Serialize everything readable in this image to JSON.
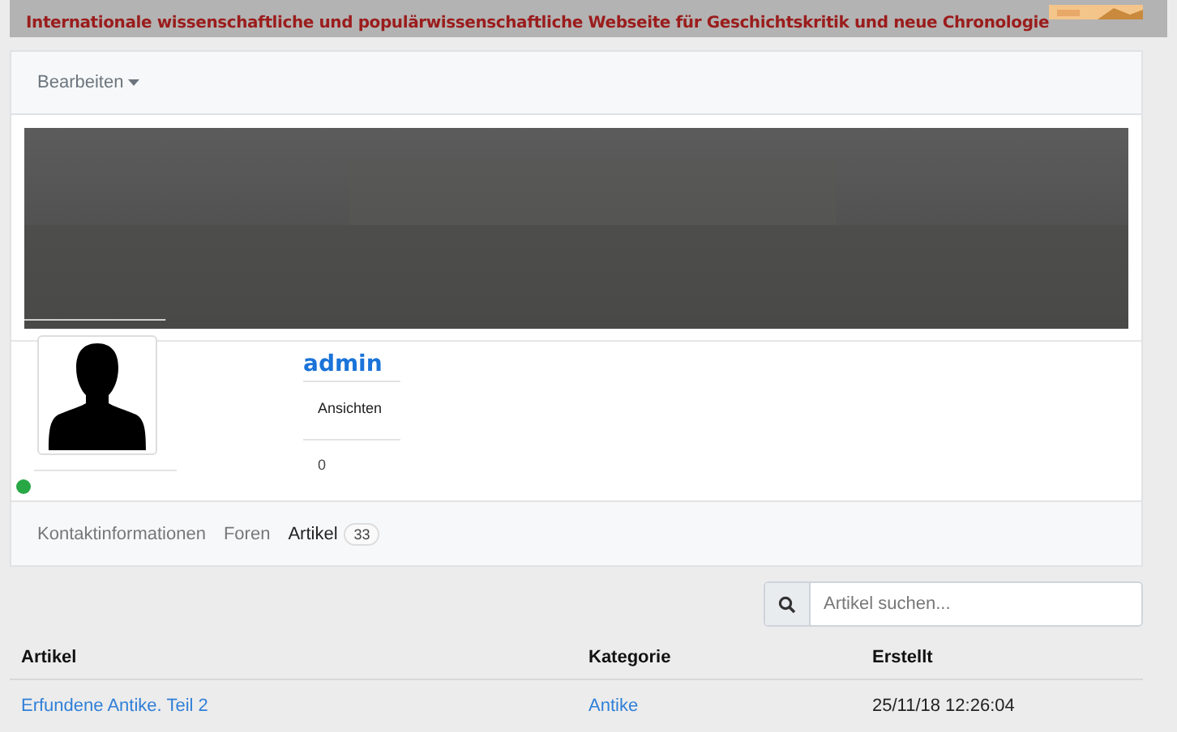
{
  "banner": {
    "tagline": "Internationale wissenschaftliche und populärwissenschaftliche Webseite für Geschichtskritik und neue Chronologie"
  },
  "toolbar": {
    "menu": "Bearbeiten"
  },
  "profile": {
    "name": "admin",
    "stat_label": "Ansichten",
    "stat_value": "0",
    "online": true
  },
  "tabs": [
    {
      "label": "Kontaktinformationen",
      "selected": false
    },
    {
      "label": "Foren",
      "selected": false
    },
    {
      "label": "Artikel",
      "selected": true,
      "count": "33"
    }
  ],
  "search": {
    "placeholder": "Artikel suchen..."
  },
  "table": {
    "columns": [
      "Artikel",
      "Kategorie",
      "Erstellt"
    ],
    "rows": [
      {
        "title": "Erfundene Antike. Teil 2",
        "category": "Antike",
        "created": "25/11/18 12:26:04"
      }
    ]
  }
}
